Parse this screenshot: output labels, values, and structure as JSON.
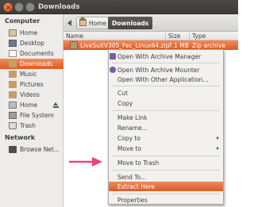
{
  "window": {
    "title": "Downloads"
  },
  "sidebar": {
    "sections": [
      {
        "label": "Computer"
      },
      {
        "label": "Network"
      }
    ],
    "items": [
      {
        "label": "Home"
      },
      {
        "label": "Desktop"
      },
      {
        "label": "Documents"
      },
      {
        "label": "Downloads"
      },
      {
        "label": "Music"
      },
      {
        "label": "Pictures"
      },
      {
        "label": "Videos"
      },
      {
        "label": "Home"
      },
      {
        "label": "File System"
      },
      {
        "label": "Trash"
      },
      {
        "label": "Browse Net..."
      }
    ],
    "active_item": "Downloads"
  },
  "breadcrumb": {
    "home": "Home",
    "current": "Downloads"
  },
  "columns": {
    "name": "Name",
    "size": "Size",
    "type": "Type"
  },
  "file": {
    "name": "LiveSuitV305_Fec_Linux64.zip",
    "size": "7.1 MB",
    "type": "Zip archive"
  },
  "context_menu": {
    "items": [
      "Open With Archive Manager",
      "Open With Archive Mounter",
      "Open With Other Application...",
      "Cut",
      "Copy",
      "Make Link",
      "Rename...",
      "Copy to",
      "Move to",
      "Move to Trash",
      "Send To...",
      "Extract Here",
      "Properties"
    ],
    "highlighted": "Extract Here"
  },
  "colors": {
    "accent": "#e0652d",
    "arrow": "#f0437b"
  }
}
